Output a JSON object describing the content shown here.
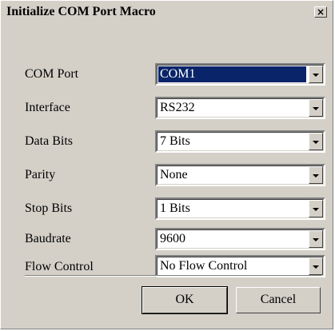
{
  "dialog": {
    "title": "Initialize COM Port Macro",
    "close_glyph": "×"
  },
  "fields": [
    {
      "label": "COM Port",
      "value": "COM1",
      "selected": true
    },
    {
      "label": "Interface",
      "value": "RS232"
    },
    {
      "label": "Data Bits",
      "value": "7 Bits"
    },
    {
      "label": "Parity",
      "value": "None"
    },
    {
      "label": "Stop Bits",
      "value": "1 Bits"
    },
    {
      "label": "Baudrate",
      "value": "9600"
    },
    {
      "label": "Flow Control",
      "value": "No Flow Control"
    }
  ],
  "buttons": {
    "ok_label": "OK",
    "cancel_label": "Cancel"
  },
  "colors": {
    "dialog_background": "#d4d0c8",
    "selection_highlight": "#0a246a"
  }
}
